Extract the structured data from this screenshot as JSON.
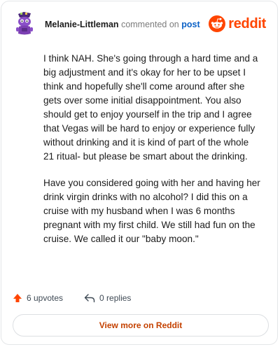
{
  "comment": {
    "author": "Melanie-Littleman",
    "action_text": "commented on",
    "target_link": "post",
    "paragraphs": [
      "I think NAH. She's going through a hard time and a big adjustment and it's okay for her to be upset I think and hopefully she'll come around after she gets over some initial disappointment. You also should get to enjoy yourself in the trip and I agree that Vegas will be hard to enjoy or experience fully without drinking and it is kind of part of the whole 21 ritual- but please be smart about the drinking.",
      "Have you considered going with her and having her drink virgin drinks with no alcohol? I did this on a cruise with my husband when I was 6 months pregnant with my first child. We still had fun on the cruise. We called it our \"baby moon.\""
    ]
  },
  "brand": {
    "wordmark": "reddit",
    "color": "#ff4500",
    "icon": "reddit-logo-icon"
  },
  "actions": {
    "upvotes_label": "6 upvotes",
    "replies_label": "0 replies",
    "upvote_icon": "upvote-arrow-icon",
    "reply_icon": "reply-arrow-icon"
  },
  "cta": {
    "label": "View more on Reddit"
  },
  "colors": {
    "upvote": "#ff4500",
    "link": "#0b61c6",
    "cta_text": "#c44100",
    "avatar": "#7b3fb2"
  }
}
